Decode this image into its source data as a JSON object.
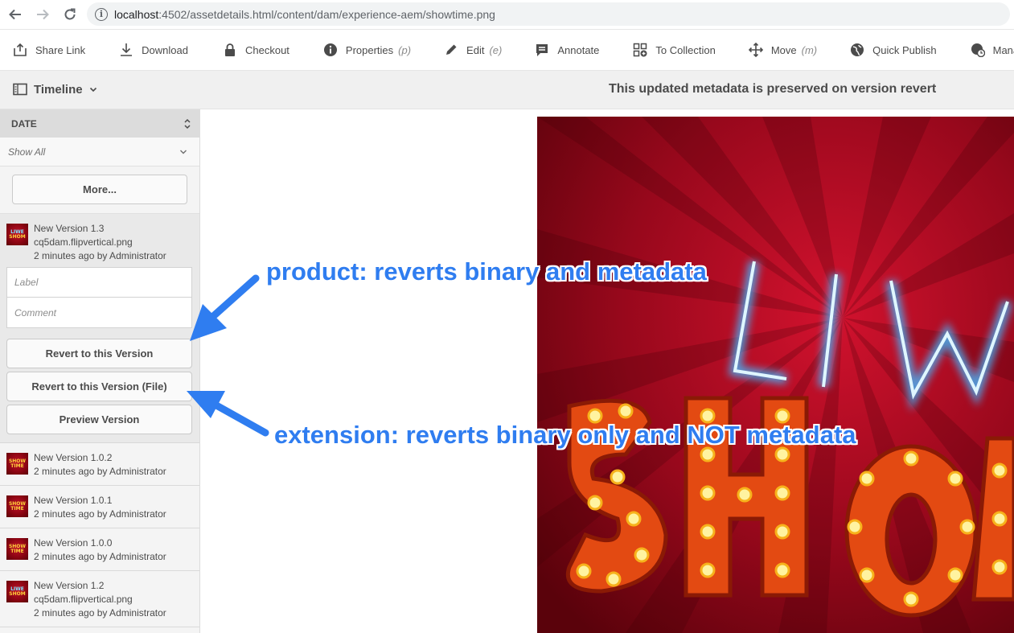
{
  "browser": {
    "url_host": "localhost",
    "url_path": ":4502/assetdetails.html/content/dam/experience-aem/showtime.png",
    "info_icon": "info-icon"
  },
  "actions": [
    {
      "label": "Share Link",
      "shortcut": "",
      "icon": "share-icon"
    },
    {
      "label": "Download",
      "shortcut": "",
      "icon": "download-icon"
    },
    {
      "label": "Checkout",
      "shortcut": "",
      "icon": "lock-icon"
    },
    {
      "label": "Properties",
      "shortcut": "(p)",
      "icon": "info-icon"
    },
    {
      "label": "Edit",
      "shortcut": "(e)",
      "icon": "pencil-icon"
    },
    {
      "label": "Annotate",
      "shortcut": "",
      "icon": "annotate-icon"
    },
    {
      "label": "To Collection",
      "shortcut": "",
      "icon": "collection-add-icon"
    },
    {
      "label": "Move",
      "shortcut": "(m)",
      "icon": "move-icon"
    },
    {
      "label": "Quick Publish",
      "shortcut": "",
      "icon": "globe-icon"
    },
    {
      "label": "Manage Publi",
      "shortcut": "",
      "icon": "globe-clock-icon"
    }
  ],
  "titlebar": {
    "rail_label": "Timeline",
    "title": "This updated metadata is preserved on version revert"
  },
  "rail": {
    "header": "DATE",
    "filter": "Show All",
    "more_button": "More...",
    "open_version": {
      "title": "New Version 1.3",
      "file": "cq5dam.flipvertical.png",
      "meta": "2 minutes ago by Administrator",
      "label_placeholder": "Label",
      "comment_placeholder": "Comment",
      "revert_button": "Revert to this Version",
      "revert_file_button": "Revert to this Version (File)",
      "preview_button": "Preview Version"
    },
    "versions": [
      {
        "title": "New Version 1.0.2",
        "file": "",
        "meta": "2 minutes ago by Administrator",
        "thumb_top": "SHOW",
        "thumb_bottom": "TIME"
      },
      {
        "title": "New Version 1.0.1",
        "file": "",
        "meta": "2 minutes ago by Administrator",
        "thumb_top": "SHOW",
        "thumb_bottom": "TIME"
      },
      {
        "title": "New Version 1.0.0",
        "file": "",
        "meta": "2 minutes ago by Administrator",
        "thumb_top": "SHOW",
        "thumb_bottom": "TIME"
      },
      {
        "title": "New Version 1.2",
        "file": "cq5dam.flipvertical.png",
        "meta": "2 minutes ago by Administrator",
        "thumb_top": "LIWE",
        "thumb_bottom": "SHOM"
      }
    ],
    "open_thumb_top": "LIWE",
    "open_thumb_bottom": "SHOM"
  },
  "annotations": {
    "product": "product: reverts binary and metadata",
    "extension": "extension: reverts binary only and NOT metadata",
    "color": "#2f7df0"
  }
}
